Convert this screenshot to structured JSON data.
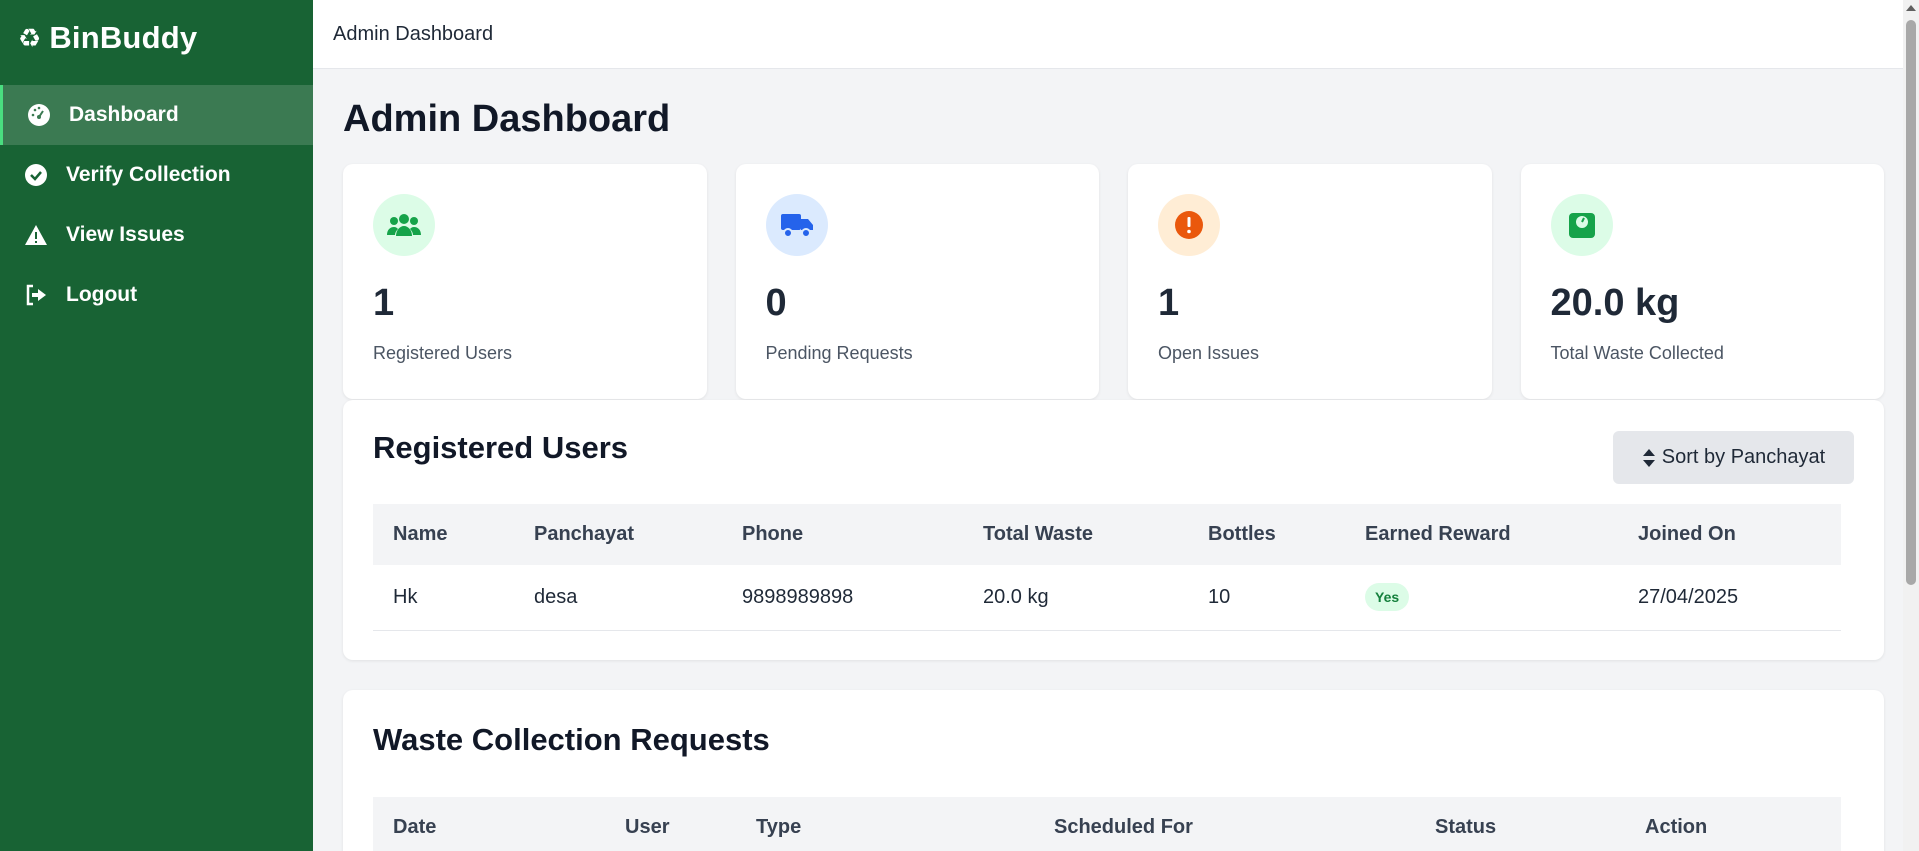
{
  "brand": {
    "name": "BinBuddy",
    "logo_icon": "recycle-icon"
  },
  "sidebar": {
    "items": [
      {
        "label": "Dashboard",
        "icon": "gauge-icon",
        "active": true
      },
      {
        "label": "Verify Collection",
        "icon": "check-circle-icon",
        "active": false
      },
      {
        "label": "View Issues",
        "icon": "warning-icon",
        "active": false
      },
      {
        "label": "Logout",
        "icon": "logout-icon",
        "active": false
      }
    ]
  },
  "topbar": {
    "title": "Admin Dashboard"
  },
  "page": {
    "title": "Admin Dashboard"
  },
  "stats": [
    {
      "value": "1",
      "label": "Registered Users",
      "icon": "users-icon",
      "color": "#16a34a",
      "bg": "#dcfce7"
    },
    {
      "value": "0",
      "label": "Pending Requests",
      "icon": "truck-icon",
      "color": "#2563eb",
      "bg": "#dbeafe"
    },
    {
      "value": "1",
      "label": "Open Issues",
      "icon": "exclamation-icon",
      "color": "#ea580c",
      "bg": "#ffedd5"
    },
    {
      "value": "20.0 kg",
      "label": "Total Waste Collected",
      "icon": "scale-icon",
      "color": "#16a34a",
      "bg": "#dcfce7"
    }
  ],
  "users_panel": {
    "title": "Registered Users",
    "sort_label": "Sort by Panchayat",
    "columns": [
      "Name",
      "Panchayat",
      "Phone",
      "Total Waste",
      "Bottles",
      "Earned Reward",
      "Joined On"
    ],
    "rows": [
      {
        "name": "Hk",
        "panchayat": "desa",
        "phone": "9898989898",
        "total_waste": "20.0 kg",
        "bottles": "10",
        "reward": "Yes",
        "joined": "27/04/2025"
      }
    ]
  },
  "requests_panel": {
    "title": "Waste Collection Requests",
    "columns": [
      "Date",
      "User",
      "Type",
      "Scheduled For",
      "Status",
      "Action"
    ]
  },
  "colors": {
    "sidebar": "#186334",
    "accent": "#16a34a"
  }
}
